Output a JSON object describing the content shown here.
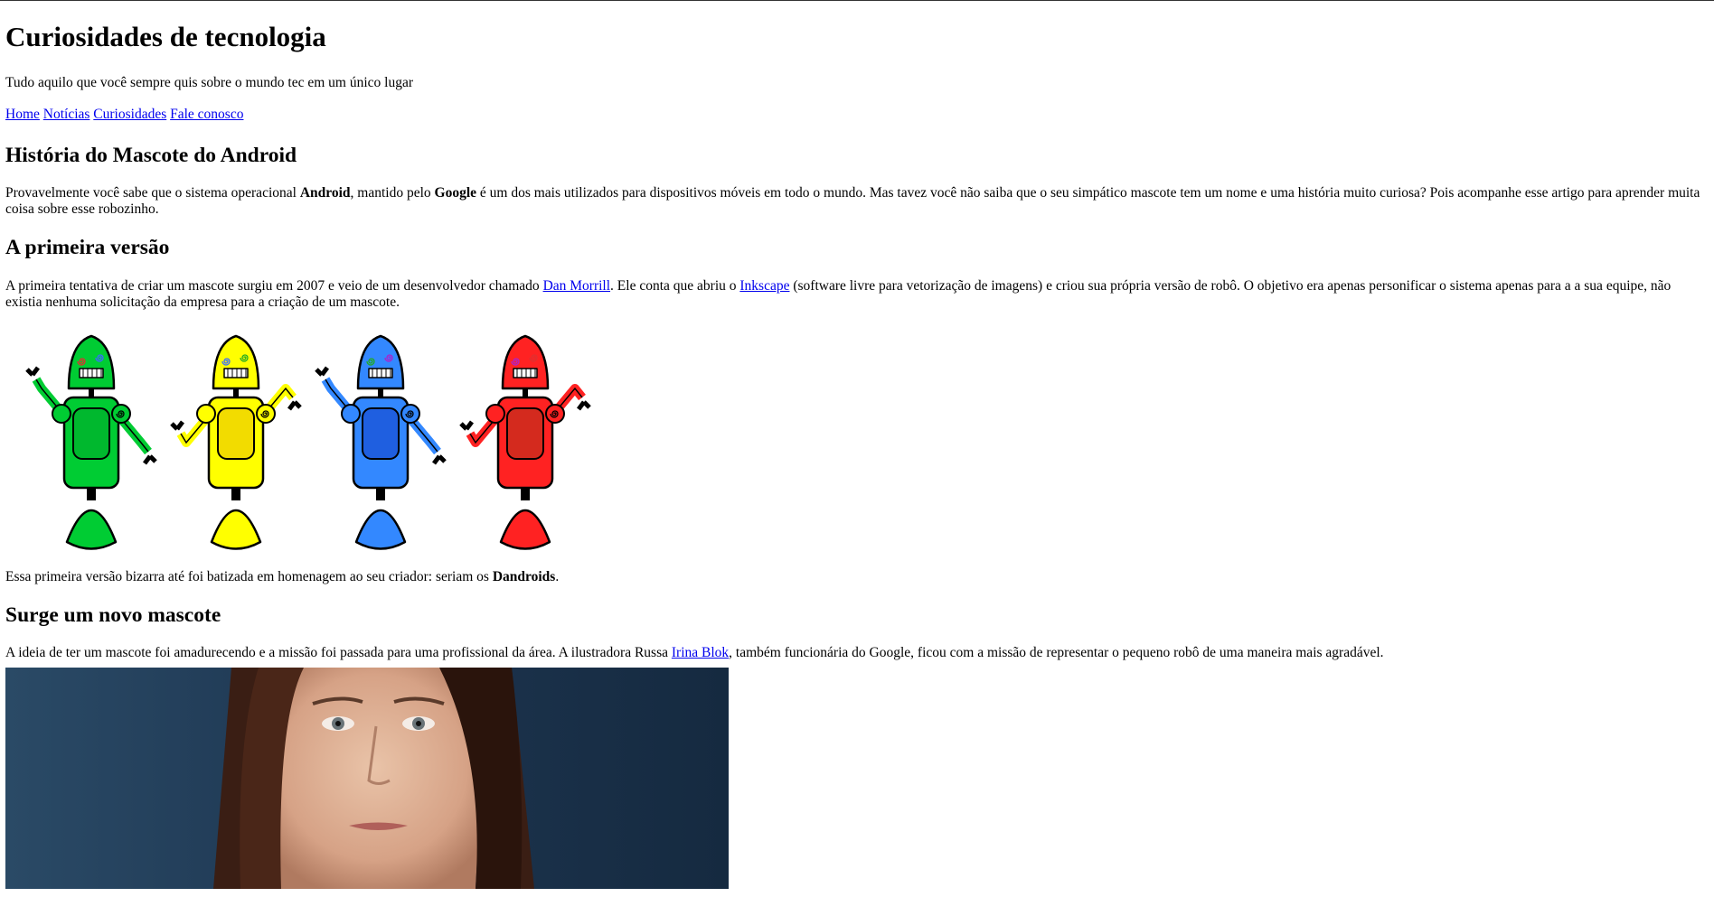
{
  "site": {
    "title": "Curiosidades de tecnologia",
    "subtitle": "Tudo aquilo que você sempre quis sobre o mundo tec em um único lugar"
  },
  "nav": [
    {
      "label": "Home"
    },
    {
      "label": "Notícias"
    },
    {
      "label": "Curiosidades"
    },
    {
      "label": "Fale conosco"
    }
  ],
  "article": {
    "heading": "História do Mascote do Android",
    "intro": {
      "t1": "Provavelmente você sabe que o sistema operacional ",
      "b1": "Android",
      "t2": ", mantido pelo ",
      "b2": "Google",
      "t3": " é um dos mais utilizados para dispositivos móveis em todo o mundo. Mas tavez você não saiba que o seu simpático mascote tem um nome e uma história muito curiosa? Pois acompanhe esse artigo para aprender muita coisa sobre esse robozinho."
    },
    "section1": {
      "heading": "A primeira versão",
      "t1": "A primeira tentativa de criar um mascote surgiu em 2007 e veio de um desenvolvedor chamado ",
      "link1": "Dan Morrill",
      "t2": ". Ele conta que abriu o ",
      "link2": "Inkscape",
      "t3": " (software livre para vetorização de imagens) e criou sua própria versão de robô. O objetivo era apenas personificar o sistema apenas para a a sua equipe, não existia nenhuma solicitação da empresa para a criação de um mascote.",
      "robots": [
        {
          "body": "#00cc33",
          "face": "#00b82e"
        },
        {
          "body": "#ffff00",
          "face": "#f2dc00"
        },
        {
          "body": "#3388ff",
          "face": "#1f5fe0"
        },
        {
          "body": "#ff2222",
          "face": "#d42a1e"
        }
      ],
      "after_t1": "Essa primeira versão bizarra até foi batizada em homenagem ao seu criador: seriam os ",
      "after_b": "Dandroids",
      "after_t2": "."
    },
    "section2": {
      "heading": "Surge um novo mascote",
      "t1": "A ideia de ter um mascote foi amadurecendo e a missão foi passada para uma profissional da área. A ilustradora Russa ",
      "link1": "Irina Blok",
      "t2": ", também funcionária do Google, ficou com a missão de representar o pequeno robô de uma maneira mais agradável."
    }
  },
  "colors": {
    "link": "#0000ee",
    "photo_bg": "#1f3a55"
  }
}
